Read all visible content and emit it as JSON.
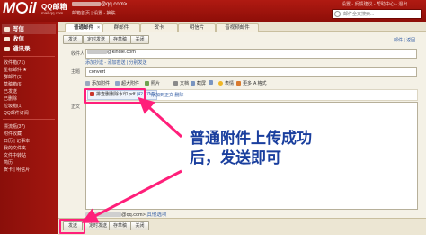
{
  "header": {
    "logo_text": "Mail",
    "logo_cn": "QQ邮箱",
    "logo_url": "mail.qq.com",
    "account_suffix": "@qq.com>",
    "account_links": "邮箱首页 | 设置 - 换肤",
    "top_links": "设置 - 反馈建议 - 帮助中心 - 退出",
    "search_placeholder": "邮件全文搜索..."
  },
  "sidebar": {
    "quick": [
      {
        "label": "写信"
      },
      {
        "label": "收信"
      },
      {
        "label": "通讯录"
      }
    ],
    "items": [
      "收件箱(71)",
      "星标邮件 ★",
      "群邮件(1)",
      "草稿箱(6)",
      "已发送",
      "已删除",
      "垃圾箱(1)",
      "QQ邮件订阅",
      "漂流瓶(37)",
      "附件收藏",
      "日历 | 记事本",
      "我的文件夹",
      "文件中转站",
      "简历",
      "贺卡 | 明信片"
    ]
  },
  "tabs": [
    {
      "label": "普通邮件"
    },
    {
      "label": "群邮件"
    },
    {
      "label": "贺卡"
    },
    {
      "label": "明信片"
    },
    {
      "label": "音视频邮件"
    }
  ],
  "toolbar": {
    "send": "发送",
    "scheduled": "定时发送",
    "save_draft": "存草稿",
    "close": "关闭",
    "right_links": "邮件 | 返回"
  },
  "form": {
    "to_label": "收件人",
    "to_value": "@kindle.com",
    "to_links": "添加抄送 - 添加密送 | 分别发送",
    "subject_label": "主题",
    "subject_value": "convert",
    "body_label": "正文"
  },
  "attach_toolbar": {
    "add_attachment": "添加附件",
    "super_attachment": "超大附件",
    "photo": "照片",
    "document": "文档",
    "screenshot": "截屏",
    "emoji": "表情",
    "more": "更多",
    "format": "A 格式"
  },
  "attachment": {
    "name": "排查删删除水印.pdf",
    "size": "(42.17M)",
    "actions": "添加到正文 删除"
  },
  "bottom": {
    "sender_suffix": "@qq.com>",
    "sender_option": "其他选项",
    "send": "发送",
    "scheduled": "定时发送",
    "save_draft": "存草稿",
    "close": "关闭"
  },
  "annotation": {
    "line1": "普通附件上传成功",
    "line2": "后，发送即可",
    "color": "#1a3f9e",
    "arrow_color": "#ff1f7a"
  }
}
